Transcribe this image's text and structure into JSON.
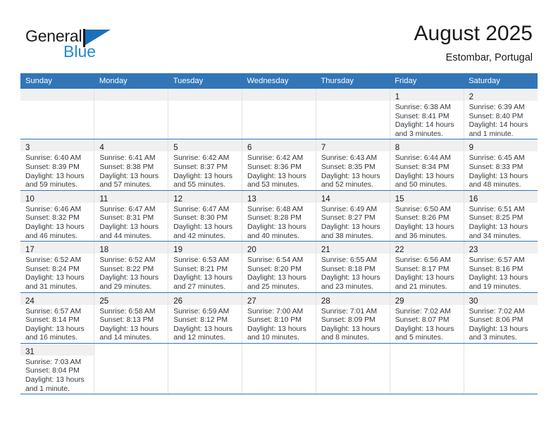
{
  "brand": {
    "name_part1": "General",
    "name_part2": "Blue",
    "flag_icon": "triangle-flag-icon"
  },
  "header": {
    "title": "August 2025",
    "subtitle": "Estombar, Portugal"
  },
  "colors": {
    "header_blue": "#3276b8",
    "brand_blue": "#2389d6",
    "daynum_band": "#f0f0f0",
    "row_divider": "#3276b8"
  },
  "weekdays": [
    "Sunday",
    "Monday",
    "Tuesday",
    "Wednesday",
    "Thursday",
    "Friday",
    "Saturday"
  ],
  "weeks": [
    [
      {
        "empty": true
      },
      {
        "empty": true
      },
      {
        "empty": true
      },
      {
        "empty": true
      },
      {
        "empty": true
      },
      {
        "day": "1",
        "sunrise": "Sunrise: 6:38 AM",
        "sunset": "Sunset: 8:41 PM",
        "daylight1": "Daylight: 14 hours",
        "daylight2": "and 3 minutes."
      },
      {
        "day": "2",
        "sunrise": "Sunrise: 6:39 AM",
        "sunset": "Sunset: 8:40 PM",
        "daylight1": "Daylight: 14 hours",
        "daylight2": "and 1 minute."
      }
    ],
    [
      {
        "day": "3",
        "sunrise": "Sunrise: 6:40 AM",
        "sunset": "Sunset: 8:39 PM",
        "daylight1": "Daylight: 13 hours",
        "daylight2": "and 59 minutes."
      },
      {
        "day": "4",
        "sunrise": "Sunrise: 6:41 AM",
        "sunset": "Sunset: 8:38 PM",
        "daylight1": "Daylight: 13 hours",
        "daylight2": "and 57 minutes."
      },
      {
        "day": "5",
        "sunrise": "Sunrise: 6:42 AM",
        "sunset": "Sunset: 8:37 PM",
        "daylight1": "Daylight: 13 hours",
        "daylight2": "and 55 minutes."
      },
      {
        "day": "6",
        "sunrise": "Sunrise: 6:42 AM",
        "sunset": "Sunset: 8:36 PM",
        "daylight1": "Daylight: 13 hours",
        "daylight2": "and 53 minutes."
      },
      {
        "day": "7",
        "sunrise": "Sunrise: 6:43 AM",
        "sunset": "Sunset: 8:35 PM",
        "daylight1": "Daylight: 13 hours",
        "daylight2": "and 52 minutes."
      },
      {
        "day": "8",
        "sunrise": "Sunrise: 6:44 AM",
        "sunset": "Sunset: 8:34 PM",
        "daylight1": "Daylight: 13 hours",
        "daylight2": "and 50 minutes."
      },
      {
        "day": "9",
        "sunrise": "Sunrise: 6:45 AM",
        "sunset": "Sunset: 8:33 PM",
        "daylight1": "Daylight: 13 hours",
        "daylight2": "and 48 minutes."
      }
    ],
    [
      {
        "day": "10",
        "sunrise": "Sunrise: 6:46 AM",
        "sunset": "Sunset: 8:32 PM",
        "daylight1": "Daylight: 13 hours",
        "daylight2": "and 46 minutes."
      },
      {
        "day": "11",
        "sunrise": "Sunrise: 6:47 AM",
        "sunset": "Sunset: 8:31 PM",
        "daylight1": "Daylight: 13 hours",
        "daylight2": "and 44 minutes."
      },
      {
        "day": "12",
        "sunrise": "Sunrise: 6:47 AM",
        "sunset": "Sunset: 8:30 PM",
        "daylight1": "Daylight: 13 hours",
        "daylight2": "and 42 minutes."
      },
      {
        "day": "13",
        "sunrise": "Sunrise: 6:48 AM",
        "sunset": "Sunset: 8:28 PM",
        "daylight1": "Daylight: 13 hours",
        "daylight2": "and 40 minutes."
      },
      {
        "day": "14",
        "sunrise": "Sunrise: 6:49 AM",
        "sunset": "Sunset: 8:27 PM",
        "daylight1": "Daylight: 13 hours",
        "daylight2": "and 38 minutes."
      },
      {
        "day": "15",
        "sunrise": "Sunrise: 6:50 AM",
        "sunset": "Sunset: 8:26 PM",
        "daylight1": "Daylight: 13 hours",
        "daylight2": "and 36 minutes."
      },
      {
        "day": "16",
        "sunrise": "Sunrise: 6:51 AM",
        "sunset": "Sunset: 8:25 PM",
        "daylight1": "Daylight: 13 hours",
        "daylight2": "and 34 minutes."
      }
    ],
    [
      {
        "day": "17",
        "sunrise": "Sunrise: 6:52 AM",
        "sunset": "Sunset: 8:24 PM",
        "daylight1": "Daylight: 13 hours",
        "daylight2": "and 31 minutes."
      },
      {
        "day": "18",
        "sunrise": "Sunrise: 6:52 AM",
        "sunset": "Sunset: 8:22 PM",
        "daylight1": "Daylight: 13 hours",
        "daylight2": "and 29 minutes."
      },
      {
        "day": "19",
        "sunrise": "Sunrise: 6:53 AM",
        "sunset": "Sunset: 8:21 PM",
        "daylight1": "Daylight: 13 hours",
        "daylight2": "and 27 minutes."
      },
      {
        "day": "20",
        "sunrise": "Sunrise: 6:54 AM",
        "sunset": "Sunset: 8:20 PM",
        "daylight1": "Daylight: 13 hours",
        "daylight2": "and 25 minutes."
      },
      {
        "day": "21",
        "sunrise": "Sunrise: 6:55 AM",
        "sunset": "Sunset: 8:18 PM",
        "daylight1": "Daylight: 13 hours",
        "daylight2": "and 23 minutes."
      },
      {
        "day": "22",
        "sunrise": "Sunrise: 6:56 AM",
        "sunset": "Sunset: 8:17 PM",
        "daylight1": "Daylight: 13 hours",
        "daylight2": "and 21 minutes."
      },
      {
        "day": "23",
        "sunrise": "Sunrise: 6:57 AM",
        "sunset": "Sunset: 8:16 PM",
        "daylight1": "Daylight: 13 hours",
        "daylight2": "and 19 minutes."
      }
    ],
    [
      {
        "day": "24",
        "sunrise": "Sunrise: 6:57 AM",
        "sunset": "Sunset: 8:14 PM",
        "daylight1": "Daylight: 13 hours",
        "daylight2": "and 16 minutes."
      },
      {
        "day": "25",
        "sunrise": "Sunrise: 6:58 AM",
        "sunset": "Sunset: 8:13 PM",
        "daylight1": "Daylight: 13 hours",
        "daylight2": "and 14 minutes."
      },
      {
        "day": "26",
        "sunrise": "Sunrise: 6:59 AM",
        "sunset": "Sunset: 8:12 PM",
        "daylight1": "Daylight: 13 hours",
        "daylight2": "and 12 minutes."
      },
      {
        "day": "27",
        "sunrise": "Sunrise: 7:00 AM",
        "sunset": "Sunset: 8:10 PM",
        "daylight1": "Daylight: 13 hours",
        "daylight2": "and 10 minutes."
      },
      {
        "day": "28",
        "sunrise": "Sunrise: 7:01 AM",
        "sunset": "Sunset: 8:09 PM",
        "daylight1": "Daylight: 13 hours",
        "daylight2": "and 8 minutes."
      },
      {
        "day": "29",
        "sunrise": "Sunrise: 7:02 AM",
        "sunset": "Sunset: 8:07 PM",
        "daylight1": "Daylight: 13 hours",
        "daylight2": "and 5 minutes."
      },
      {
        "day": "30",
        "sunrise": "Sunrise: 7:02 AM",
        "sunset": "Sunset: 8:06 PM",
        "daylight1": "Daylight: 13 hours",
        "daylight2": "and 3 minutes."
      }
    ],
    [
      {
        "day": "31",
        "sunrise": "Sunrise: 7:03 AM",
        "sunset": "Sunset: 8:04 PM",
        "daylight1": "Daylight: 13 hours",
        "daylight2": "and 1 minute."
      },
      {
        "blank": true
      },
      {
        "blank": true
      },
      {
        "blank": true
      },
      {
        "blank": true
      },
      {
        "blank": true
      },
      {
        "blank": true
      }
    ]
  ]
}
